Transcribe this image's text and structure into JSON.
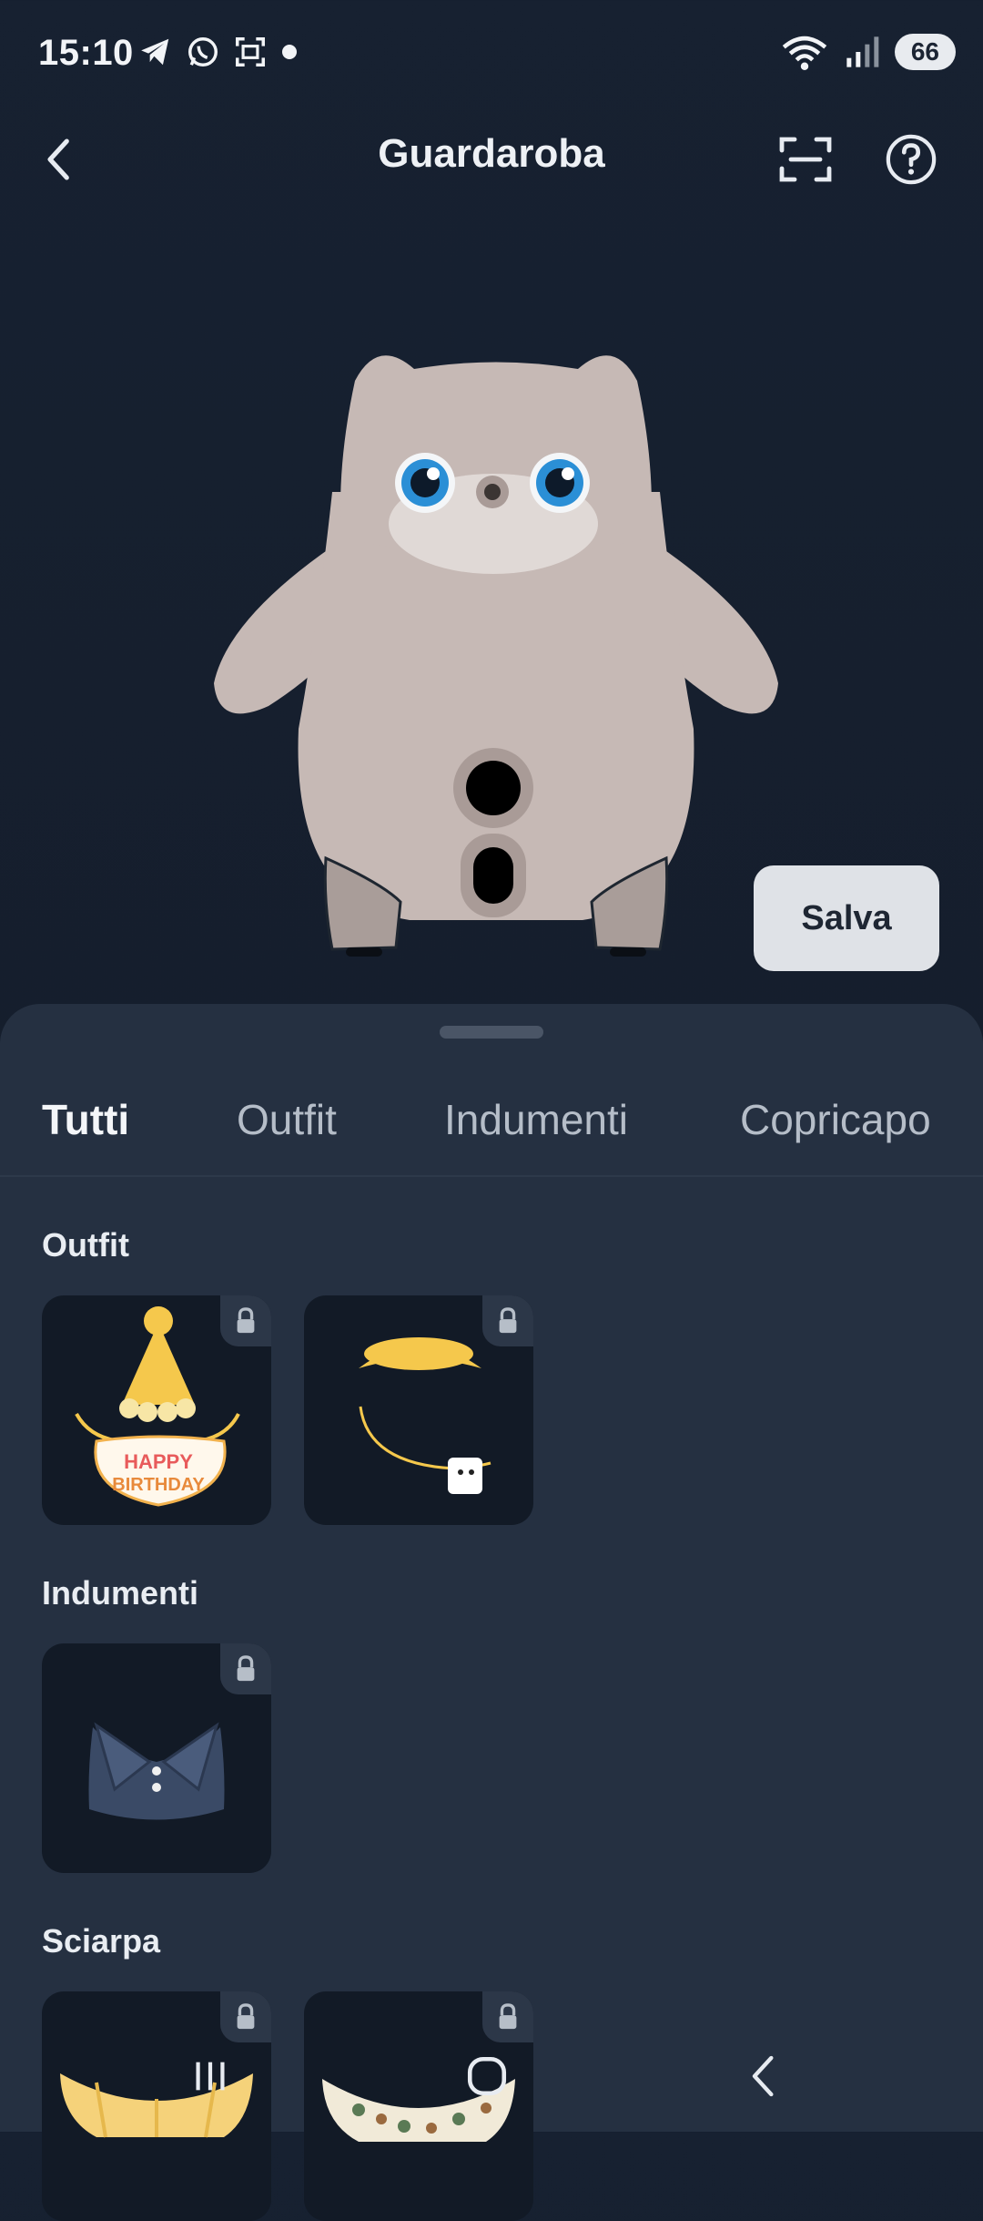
{
  "status_bar": {
    "time": "15:10",
    "battery": "66",
    "left_icons": [
      "telegram-icon",
      "whatsapp-icon",
      "screenshot-icon",
      "dot-icon"
    ],
    "right_icons": [
      "wifi-icon",
      "signal-icon",
      "battery-icon"
    ]
  },
  "header": {
    "title": "Guardaroba",
    "back_icon": "chevron-left-icon",
    "scan_icon": "scan-icon",
    "help_icon": "help-icon"
  },
  "robot": {
    "colors": {
      "body": "#c6b9b5",
      "face": "#e0d9d6",
      "eye": "#2b8fd6"
    }
  },
  "save_button": {
    "label": "Salva"
  },
  "tabs": [
    {
      "label": "Tutti",
      "active": true
    },
    {
      "label": "Outfit",
      "active": false
    },
    {
      "label": "Indumenti",
      "active": false
    },
    {
      "label": "Copricapo",
      "active": false
    }
  ],
  "sections": [
    {
      "title": "Outfit",
      "items": [
        "birthday-hat-bib",
        "yellow-beret-necklace"
      ]
    },
    {
      "title": "Indumenti",
      "items": [
        "denim-collar"
      ]
    },
    {
      "title": "Sciarpa",
      "items": [
        "plaid-scarf",
        "pattern-scarf"
      ]
    }
  ],
  "birthday_bib_text": "HAPPY BIRTHDAY",
  "nav_bar": {
    "icons": [
      "recent-apps-icon",
      "home-icon",
      "back-icon"
    ]
  },
  "colors": {
    "background": "#172131",
    "panel": "#253041",
    "card": "#121a26",
    "accent": "#f5c84c"
  }
}
